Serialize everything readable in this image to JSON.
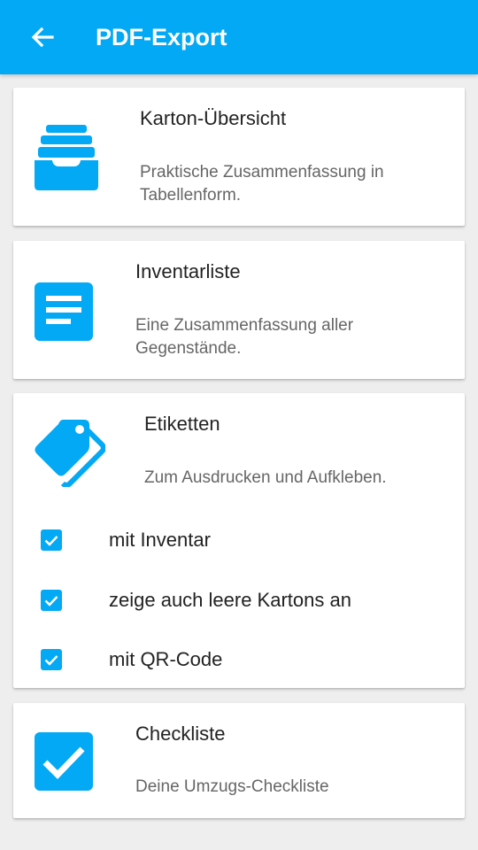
{
  "appbar": {
    "title": "PDF-Export",
    "back_icon": "arrow-left-icon",
    "color": "#03a9f4"
  },
  "cards": [
    {
      "icon": "archive-box-icon",
      "title": "Karton-Übersicht",
      "description": "Praktische Zusammenfassung in Tabellenform."
    },
    {
      "icon": "document-list-icon",
      "title": "Inventarliste",
      "description": "Eine Zusammenfassung aller Gegenstände."
    },
    {
      "icon": "labels-icon",
      "title": "Etiketten",
      "description": "Zum Ausdrucken und Aufkleben.",
      "options": [
        {
          "label": "mit Inventar",
          "checked": true
        },
        {
          "label": "zeige auch leere Kartons an",
          "checked": true
        },
        {
          "label": "mit QR-Code",
          "checked": true
        }
      ]
    },
    {
      "icon": "checkbox-icon",
      "title": "Checkliste",
      "description": "Deine Umzugs-Checkliste"
    }
  ],
  "colors": {
    "accent": "#03a9f4",
    "background": "#eeeeee",
    "card": "#ffffff"
  }
}
